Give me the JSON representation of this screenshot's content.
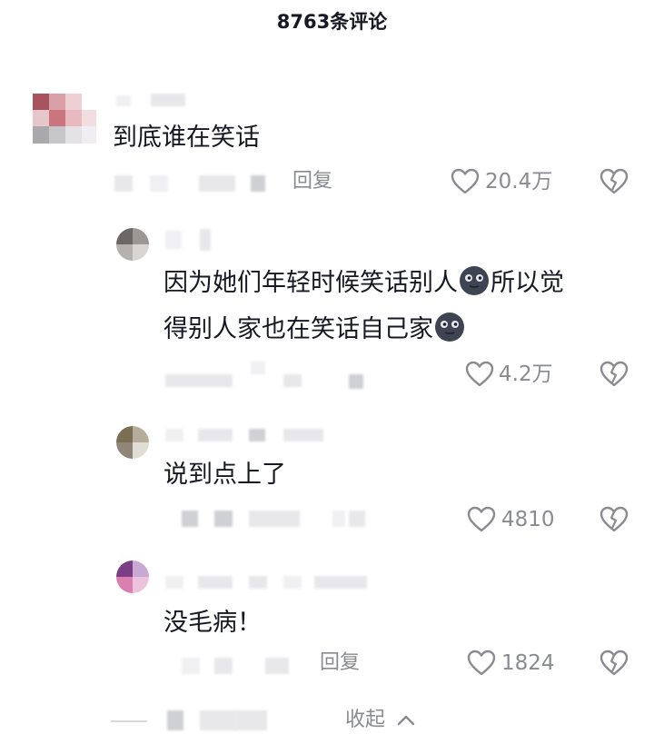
{
  "header": {
    "title": "8763条评论"
  },
  "comments": [
    {
      "text": "到底谁在笑话",
      "reply_label": "回复",
      "likes": "20.4万"
    },
    {
      "text_line1": "因为她们年轻时候笑话别人",
      "text_line1_tail": "所以觉",
      "text_line2": "得别人家也在笑话自己家",
      "likes": "4.2万",
      "emoji": "new-moon-face"
    },
    {
      "text": "说到点上了",
      "likes": "4810"
    },
    {
      "text": "没毛病！",
      "reply_label": "回复",
      "likes": "1824"
    }
  ],
  "footer": {
    "collapse_label": "收起"
  },
  "colors": {
    "text": "#161823",
    "secondary": "#8a8b91",
    "blur": "#e8e8ea"
  }
}
